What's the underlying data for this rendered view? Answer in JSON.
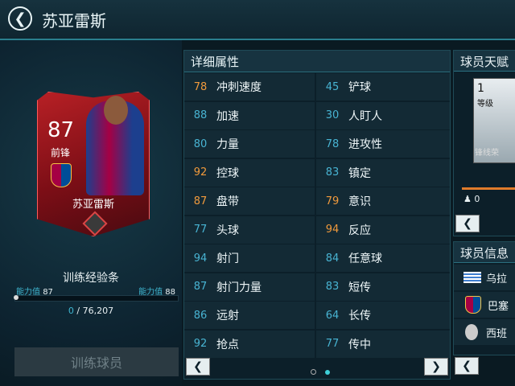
{
  "header": {
    "title": "苏亚雷斯",
    "back_label": "❮"
  },
  "card": {
    "rating": "87",
    "position": "前锋",
    "name": "苏亚雷斯"
  },
  "training": {
    "title": "训练经验条",
    "left_label": "能力值",
    "left_value": "87",
    "right_label": "能力值",
    "right_value": "88",
    "current": "0",
    "separator": "/",
    "total": "76,207",
    "progress": 0,
    "button_label": "训练球员"
  },
  "stats": {
    "title": "详细属性",
    "rows": [
      {
        "left": {
          "value": "78",
          "label": "冲刺速度",
          "color": "orange"
        },
        "right": {
          "value": "45",
          "label": "铲球",
          "color": "blue"
        }
      },
      {
        "left": {
          "value": "88",
          "label": "加速",
          "color": "blue"
        },
        "right": {
          "value": "30",
          "label": "人盯人",
          "color": "blue"
        }
      },
      {
        "left": {
          "value": "80",
          "label": "力量",
          "color": "blue"
        },
        "right": {
          "value": "78",
          "label": "进攻性",
          "color": "blue"
        }
      },
      {
        "left": {
          "value": "92",
          "label": "控球",
          "color": "orange"
        },
        "right": {
          "value": "83",
          "label": "镇定",
          "color": "blue"
        }
      },
      {
        "left": {
          "value": "87",
          "label": "盘带",
          "color": "orange"
        },
        "right": {
          "value": "79",
          "label": "意识",
          "color": "orange"
        }
      },
      {
        "left": {
          "value": "77",
          "label": "头球",
          "color": "blue"
        },
        "right": {
          "value": "94",
          "label": "反应",
          "color": "orange"
        }
      },
      {
        "left": {
          "value": "94",
          "label": "射门",
          "color": "blue"
        },
        "right": {
          "value": "84",
          "label": "任意球",
          "color": "blue"
        }
      },
      {
        "left": {
          "value": "87",
          "label": "射门力量",
          "color": "blue"
        },
        "right": {
          "value": "83",
          "label": "短传",
          "color": "blue"
        }
      },
      {
        "left": {
          "value": "86",
          "label": "远射",
          "color": "blue"
        },
        "right": {
          "value": "64",
          "label": "长传",
          "color": "blue"
        }
      },
      {
        "left": {
          "value": "92",
          "label": "抢点",
          "color": "blue"
        },
        "right": {
          "value": "77",
          "label": "传中",
          "color": "blue"
        }
      }
    ],
    "prev_label": "❮",
    "next_label": "❯",
    "page_count": 2,
    "active_page": 2
  },
  "talent": {
    "title": "球员天赋",
    "level": "1",
    "level_label": "等级",
    "skill_name": "锋线荣",
    "count": "0",
    "prev_label": "❮"
  },
  "info": {
    "title": "球员信息",
    "rows": [
      {
        "icon": "uruguay-flag-icon",
        "text": "乌拉"
      },
      {
        "icon": "barcelona-crest-icon",
        "text": "巴塞"
      },
      {
        "icon": "laliga-logo-icon",
        "text": "西班"
      }
    ],
    "prev_label": "❮"
  },
  "colors": {
    "accent": "#2a7f8e",
    "orange": "#f19a3c",
    "blue": "#48b4d3",
    "card_red": "#b72025"
  }
}
